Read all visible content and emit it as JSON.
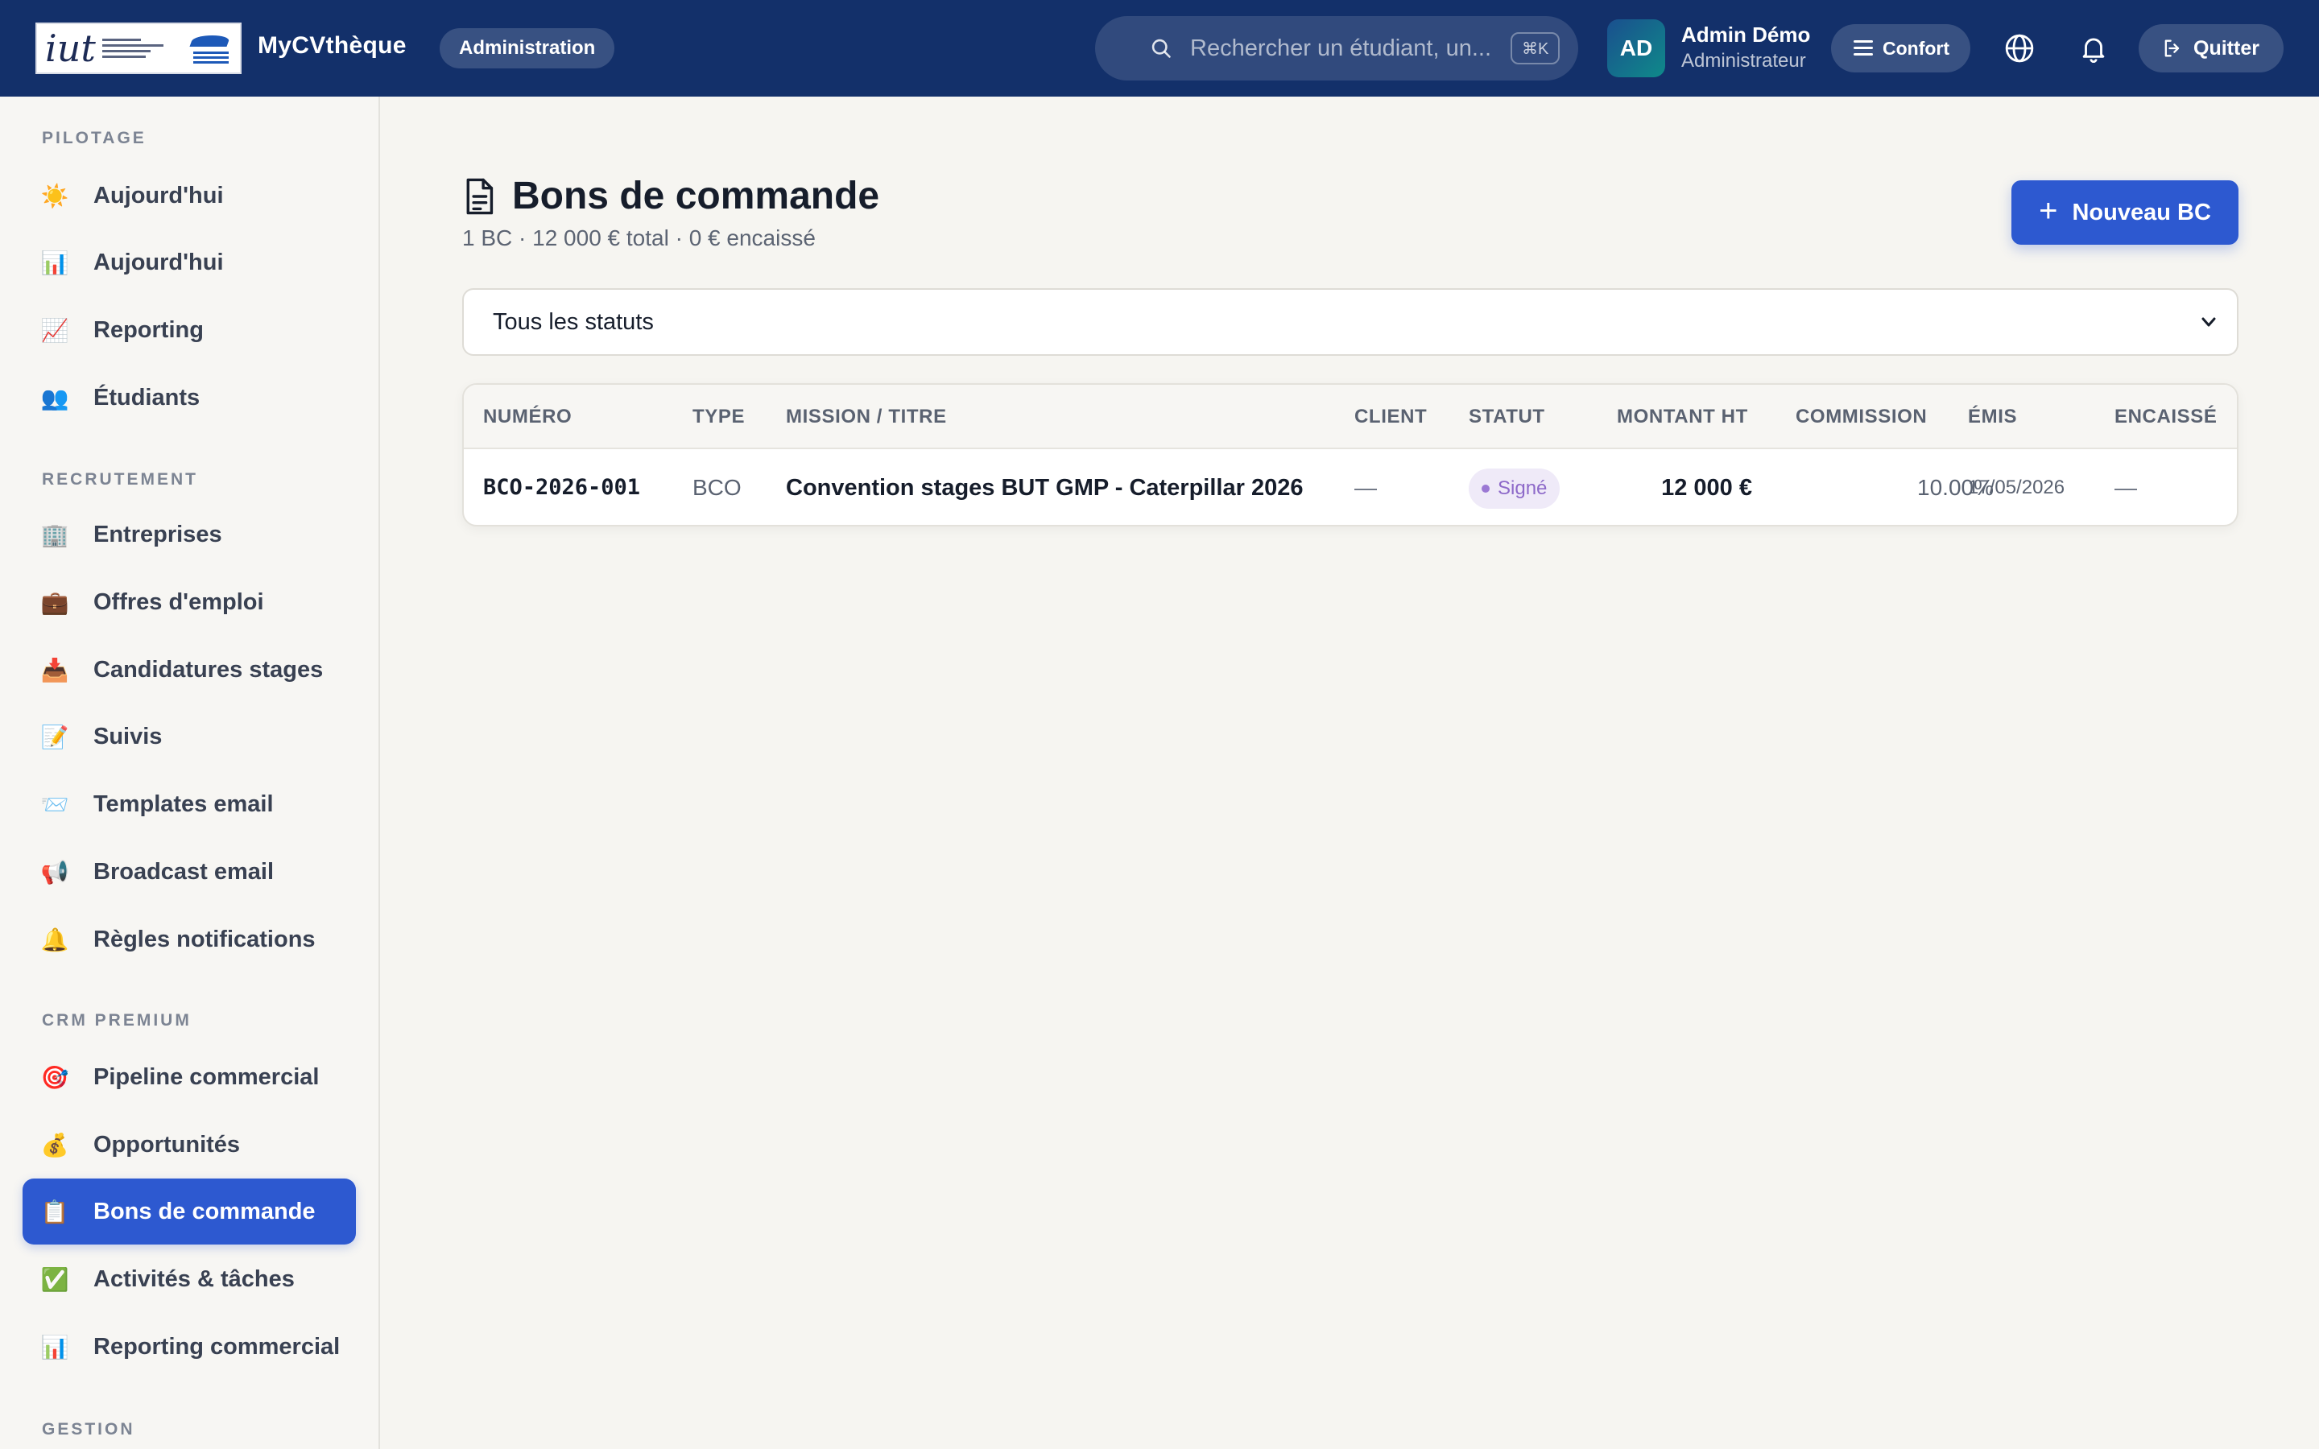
{
  "header": {
    "brand": "MyCVthèque",
    "role_pill": "Administration",
    "search_placeholder": "Rechercher un étudiant, un...",
    "search_shortcut": "⌘K",
    "avatar_initials": "AD",
    "user_name": "Admin Démo",
    "user_role": "Administrateur",
    "density_label": "Confort",
    "quit_label": "Quitter"
  },
  "sidebar": {
    "sections": [
      {
        "title": "PILOTAGE",
        "items": [
          {
            "emoji": "☀️",
            "label": "Aujourd'hui"
          },
          {
            "emoji": "📊",
            "label": "Aujourd'hui"
          },
          {
            "emoji": "📈",
            "label": "Reporting"
          },
          {
            "emoji": "👥",
            "label": "Étudiants"
          }
        ]
      },
      {
        "title": "RECRUTEMENT",
        "items": [
          {
            "emoji": "🏢",
            "label": "Entreprises"
          },
          {
            "emoji": "💼",
            "label": "Offres d'emploi"
          },
          {
            "emoji": "📥",
            "label": "Candidatures stages"
          },
          {
            "emoji": "📝",
            "label": "Suivis"
          },
          {
            "emoji": "📨",
            "label": "Templates email"
          },
          {
            "emoji": "📢",
            "label": "Broadcast email"
          },
          {
            "emoji": "🔔",
            "label": "Règles notifications"
          }
        ]
      },
      {
        "title": "CRM PREMIUM",
        "items": [
          {
            "emoji": "🎯",
            "label": "Pipeline commercial"
          },
          {
            "emoji": "💰",
            "label": "Opportunités"
          },
          {
            "emoji": "📋",
            "label": "Bons de commande",
            "active": true
          },
          {
            "emoji": "✅",
            "label": "Activités & tâches"
          },
          {
            "emoji": "📊",
            "label": "Reporting commercial"
          }
        ]
      },
      {
        "title": "GESTION",
        "items": []
      }
    ]
  },
  "page": {
    "title": "Bons de commande",
    "subtitle": "1 BC · 12 000 € total · 0 € encaissé",
    "new_button_label": "Nouveau BC",
    "status_filter": {
      "selected": "Tous les statuts"
    }
  },
  "table": {
    "columns": [
      "NUMÉRO",
      "TYPE",
      "MISSION / TITRE",
      "CLIENT",
      "STATUT",
      "MONTANT HT",
      "COMMISSION",
      "ÉMIS",
      "ENCAISSÉ"
    ],
    "rows": [
      {
        "numero": "BCO-2026-001",
        "type": "BCO",
        "mission": "Convention stages BUT GMP - Caterpillar 2026",
        "client": "—",
        "statut": "Signé",
        "montant": "12 000 €",
        "commission": "10.00%",
        "emis": "17/05/2026",
        "encaisse": "—"
      }
    ]
  },
  "colors": {
    "topbar": "#13306a",
    "accent": "#2d59d0",
    "background": "#f6f5f1",
    "badge_signed_bg": "#efeaf8",
    "badge_signed_text": "#8d69c9"
  },
  "icons": {
    "search": "search-icon",
    "language": "globe-icon",
    "notifications": "bell-icon",
    "logout": "logout-icon",
    "page": "document-icon",
    "add": "plus-icon",
    "select": "chevron-down-icon"
  }
}
